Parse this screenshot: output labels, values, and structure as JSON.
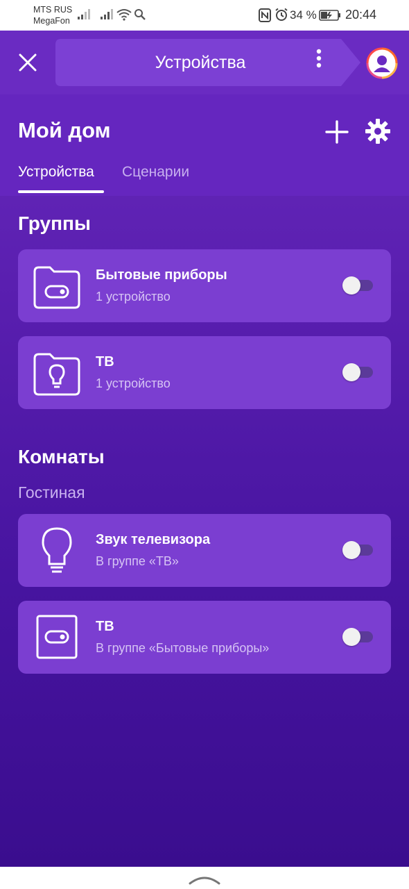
{
  "status_bar": {
    "carrier_1": "MTS RUS",
    "carrier_2": "MegaFon",
    "battery": "34 %",
    "time": "20:44"
  },
  "topbar": {
    "title": "Устройства"
  },
  "home": {
    "title": "Мой дом",
    "tabs": [
      {
        "label": "Устройства",
        "active": true
      },
      {
        "label": "Сценарии",
        "active": false
      }
    ]
  },
  "groups": {
    "title": "Группы",
    "items": [
      {
        "name": "Бытовые приборы",
        "sub": "1 устройство",
        "icon": "folder-switch-icon",
        "on": false
      },
      {
        "name": "ТВ",
        "sub": "1 устройство",
        "icon": "folder-bulb-icon",
        "on": false
      }
    ]
  },
  "rooms": {
    "title": "Комнаты",
    "room_name": "Гостиная",
    "items": [
      {
        "name": "Звук телевизора",
        "sub": "В группе «ТВ»",
        "icon": "bulb-icon",
        "on": false
      },
      {
        "name": "ТВ",
        "sub": "В группе «Бытовые приборы»",
        "icon": "socket-switch-icon",
        "on": false
      }
    ]
  },
  "colors": {
    "accent": "#6a2bc2",
    "card": "#7b3ed1",
    "avatar_ring": "#ff6a2a"
  }
}
